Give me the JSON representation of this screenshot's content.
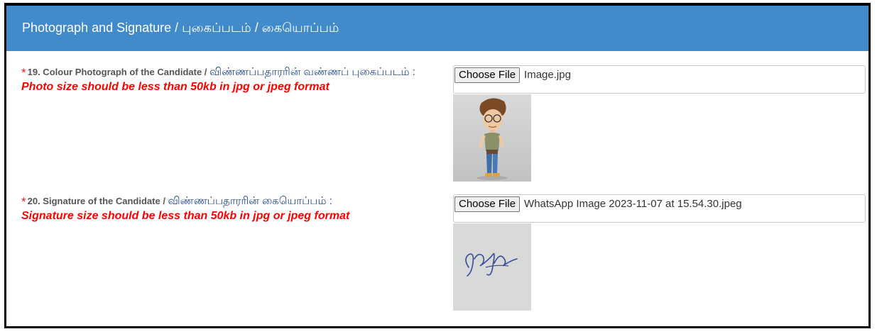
{
  "header": {
    "title": "Photograph and Signature / புகைப்படம் / கையொப்பம்"
  },
  "fields": [
    {
      "required_mark": "*",
      "label_en": "19. Colour Photograph of the Candidate / ",
      "label_ta": "விண்ணப்பதாரரின் வண்ணப் புகைப்படம் :",
      "hint": "Photo size should be less than 50kb in jpg or jpeg format",
      "button_label": "Choose File",
      "file_name": "Image.jpg",
      "preview_icon": "cartoon-photo-icon"
    },
    {
      "required_mark": "*",
      "label_en": "20. Signature of the Candidate / ",
      "label_ta": "விண்ணப்பதாரரின் கையொப்பம் :",
      "hint": "Signature size should be less than 50kb in jpg or jpeg format",
      "button_label": "Choose File",
      "file_name": "WhatsApp Image 2023-11-07 at 15.54.30.jpeg",
      "preview_icon": "signature-icon"
    }
  ],
  "colors": {
    "header_bg": "#428bca",
    "hint": "#ff0000",
    "required": "#e02020",
    "tamil_label": "#2b4f8c"
  }
}
